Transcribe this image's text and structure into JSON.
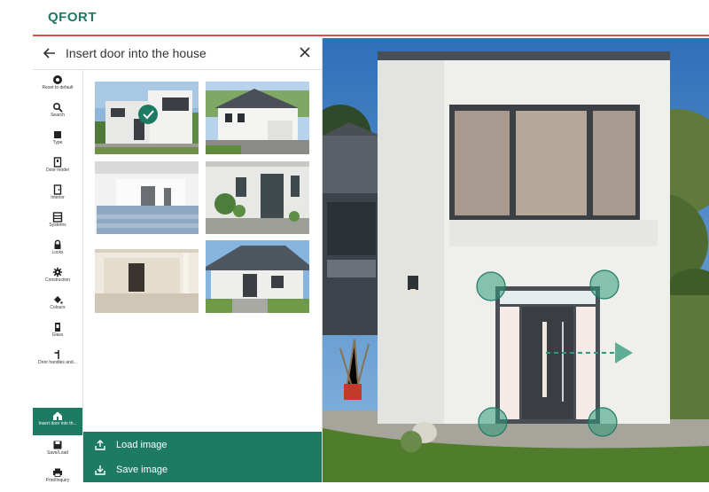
{
  "brand": {
    "logo_text": "QFORT",
    "accent": "#1d7a63",
    "topline": "#d9534f"
  },
  "panel": {
    "title": "Insert door into the house",
    "back_icon": "arrow-left-icon",
    "close_icon": "close-icon"
  },
  "rail": {
    "items": [
      {
        "label": "Reset to default",
        "icon": "reset-icon"
      },
      {
        "label": "Search",
        "icon": "search-icon"
      },
      {
        "label": "Type",
        "icon": "square-icon"
      },
      {
        "label": "Door model",
        "icon": "door-icon"
      },
      {
        "label": "Interior",
        "icon": "interior-icon"
      },
      {
        "label": "Systems",
        "icon": "systems-icon"
      },
      {
        "label": "Locks",
        "icon": "lock-icon"
      },
      {
        "label": "Construction",
        "icon": "gear-icon"
      },
      {
        "label": "Colours",
        "icon": "paint-bucket-icon"
      },
      {
        "label": "Glass",
        "icon": "glass-icon"
      },
      {
        "label": "Door handles and...",
        "icon": "handle-icon"
      },
      {
        "label": "Insert door into th...",
        "icon": "house-icon"
      },
      {
        "label": "Save/Load",
        "icon": "save-icon"
      },
      {
        "label": "Print/Inquiry",
        "icon": "print-icon"
      }
    ],
    "active_index": 11
  },
  "thumbnails": [
    {
      "name": "modern-white-house",
      "selected": true
    },
    {
      "name": "white-gable-house",
      "selected": false
    },
    {
      "name": "white-porch-entrance",
      "selected": false
    },
    {
      "name": "entrance-with-plants",
      "selected": false
    },
    {
      "name": "covered-carport-entrance",
      "selected": false
    },
    {
      "name": "bungalow-grey-roof",
      "selected": false
    }
  ],
  "actions": {
    "load_label": "Load image",
    "save_label": "Save image"
  }
}
